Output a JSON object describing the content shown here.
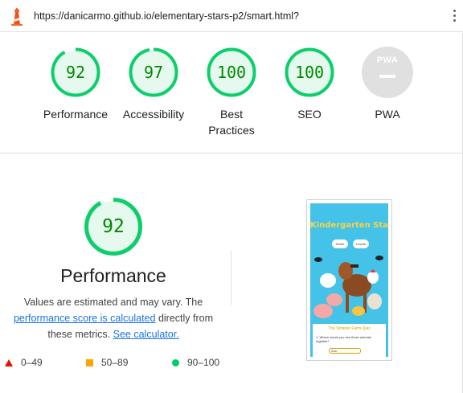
{
  "browser": {
    "url": "https://danicarmo.github.io/elementary-stars-p2/smart.html?",
    "logo_icon": "lighthouse-icon",
    "menu_icon": "kebab-menu-icon"
  },
  "scores": [
    {
      "label": "Performance",
      "value": "92",
      "fraction": 0.92
    },
    {
      "label": "Accessibility",
      "value": "97",
      "fraction": 0.97
    },
    {
      "label": "Best Practices",
      "value": "100",
      "fraction": 1.0
    },
    {
      "label": "SEO",
      "value": "100",
      "fraction": 1.0
    },
    {
      "label": "PWA",
      "badge_text": "PWA"
    }
  ],
  "performance": {
    "score": "92",
    "fraction": 0.92,
    "title": "Performance",
    "desc_part1": "Values are estimated and may vary. The",
    "link1": "performance score is calculated",
    "desc_part2": "directly from these metrics.",
    "link2": "See calculator."
  },
  "legend": [
    {
      "range": "0–49",
      "shape": "triangle",
      "color": "#eb0f00"
    },
    {
      "range": "50–89",
      "shape": "square",
      "color": "#ffa400"
    },
    {
      "range": "90–100",
      "shape": "circle",
      "color": "#00cc66"
    }
  ],
  "thumbnail": {
    "title": "Kindergarten Stars",
    "button_home": "Home",
    "button_levels": "Levels",
    "quiz_title": "The Smarter Farm Quiz",
    "quiz_question": "1. Where would you see these animals together?",
    "quiz_answer": "Zoo"
  },
  "colors": {
    "pass": "#0cce6b",
    "pass_text": "#008800",
    "pass_bg": "#e6f9ee",
    "link": "#1a73e8"
  }
}
